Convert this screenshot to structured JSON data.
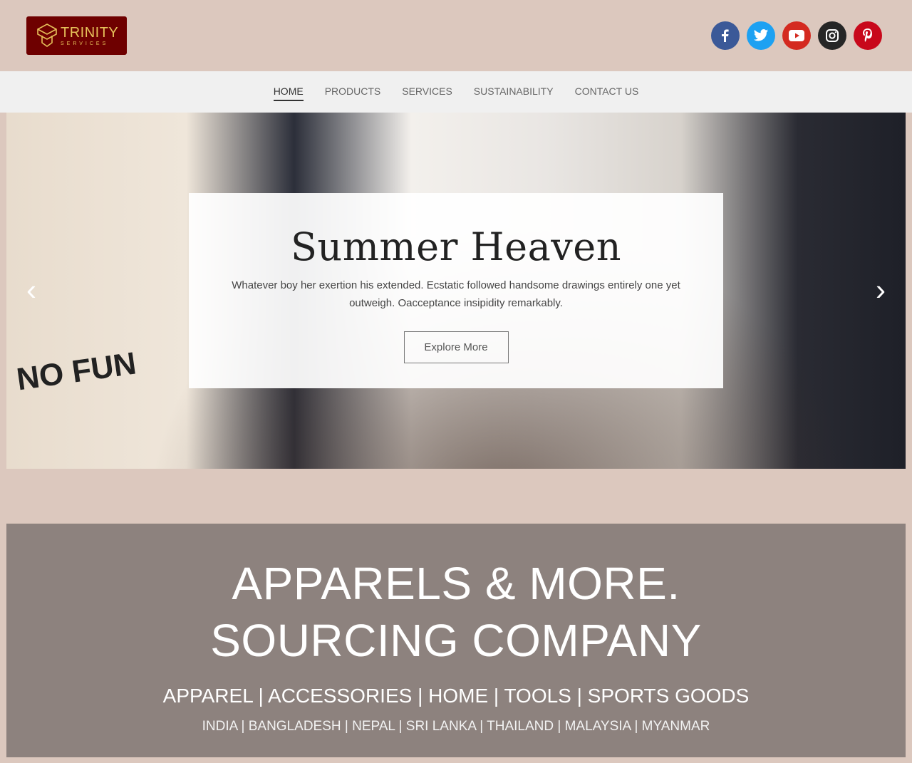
{
  "header": {
    "logo": {
      "name": "TRINITY",
      "tagline": "SERVICES",
      "bg": "#6e0000",
      "color": "#e6c15a"
    },
    "social": [
      {
        "name": "facebook-icon",
        "color": "#3b5998"
      },
      {
        "name": "twitter-icon",
        "color": "#1da1f2"
      },
      {
        "name": "youtube-icon",
        "color": "#d42a20"
      },
      {
        "name": "instagram-icon",
        "color": "#262626"
      },
      {
        "name": "pinterest-icon",
        "color": "#c8081b"
      }
    ]
  },
  "nav": {
    "items": [
      "HOME",
      "PRODUCTS",
      "SERVICES",
      "SUSTAINABILITY",
      "CONTACT US"
    ],
    "active": "HOME"
  },
  "hero": {
    "title": "Summer Heaven",
    "text": "Whatever boy her exertion his extended. Ecstatic followed handsome drawings entirely one yet outweigh. Oacceptance insipidity remarkably.",
    "button": "Explore More",
    "prev": "‹",
    "next": "›",
    "image_text": "NO FUN"
  },
  "band": {
    "line1": "APPARELS & MORE.",
    "line2": "SOURCING COMPANY",
    "categories": "APPAREL | ACCESSORIES | HOME | TOOLS | SPORTS GOODS",
    "countries": "INDIA | BANGLADESH | NEPAL | SRI LANKA | THAILAND | MALAYSIA | MYANMAR"
  }
}
